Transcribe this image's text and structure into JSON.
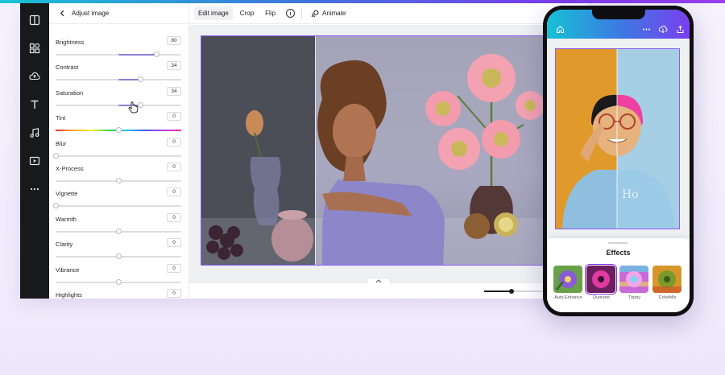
{
  "panel": {
    "title": "Adjust image",
    "adjustments": [
      {
        "label": "Brightness",
        "value": "80",
        "level": 0.8
      },
      {
        "label": "Contrast",
        "value": "34",
        "level": 0.67
      },
      {
        "label": "Saturation",
        "value": "34",
        "level": 0.67
      },
      {
        "label": "Tint",
        "value": "0",
        "level": 0.5
      },
      {
        "label": "Blur",
        "value": "0",
        "level": 0.0
      },
      {
        "label": "X-Process",
        "value": "0",
        "level": 0.5
      },
      {
        "label": "Vignette",
        "value": "0",
        "level": 0.0
      },
      {
        "label": "Warmth",
        "value": "0",
        "level": 0.5
      },
      {
        "label": "Clarity",
        "value": "0",
        "level": 0.5
      },
      {
        "label": "Vibrance",
        "value": "0",
        "level": 0.5
      },
      {
        "label": "Highlights",
        "value": "0",
        "level": 0.5
      }
    ]
  },
  "toolbar": {
    "edit_image": "Edit image",
    "crop": "Crop",
    "flip": "Flip",
    "animate": "Animate"
  },
  "zoom": {
    "level": 0.42
  },
  "phone": {
    "effects_title": "Effects",
    "effects": [
      {
        "label": "Auto Enhance",
        "selected": false
      },
      {
        "label": "Duotone",
        "selected": true
      },
      {
        "label": "Trippy",
        "selected": false
      },
      {
        "label": "ColorMix",
        "selected": false
      }
    ]
  },
  "colors": {
    "accent": "#8b5cf6",
    "rail_background": "#18191b",
    "slider_fill": "#8c7fd6",
    "gradient_start": "#16c1d5",
    "gradient_end": "#7a3ff0"
  },
  "icons": {
    "rail": [
      "templates-icon",
      "elements-icon",
      "uploads-icon",
      "text-icon",
      "audio-icon",
      "videos-icon",
      "more-icon"
    ],
    "toolbar": [
      "info-icon",
      "animate-icon"
    ],
    "phone": [
      "home-icon",
      "more-icon",
      "download-icon",
      "share-icon"
    ]
  }
}
